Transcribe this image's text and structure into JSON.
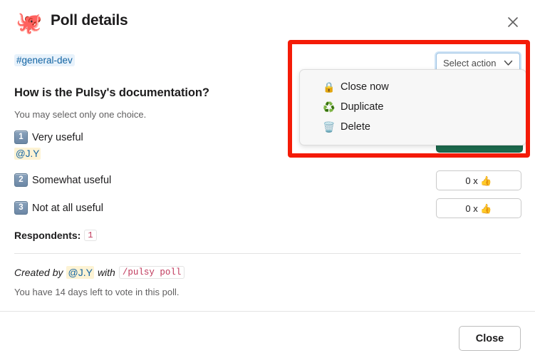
{
  "header": {
    "logo_glyph": "🐙",
    "title": "Poll details",
    "close_label": "×"
  },
  "body": {
    "channel": "#general-dev",
    "question": "How is the Pulsy's documentation?",
    "subtitle": "You may select only one choice.",
    "options": [
      {
        "number": "1",
        "label": "Very useful",
        "voters": "@J.Y",
        "vote_count": ""
      },
      {
        "number": "2",
        "label": "Somewhat useful",
        "voters": "",
        "vote_count": "0 x 👍"
      },
      {
        "number": "3",
        "label": "Not at all useful",
        "voters": "",
        "vote_count": "0 x 👍"
      }
    ],
    "respondents_label": "Respondents:",
    "respondents_count": "1",
    "created_by_prefix": "Created by",
    "created_by_user": "@J.Y",
    "created_with": "with",
    "created_command": "/pulsy poll",
    "expiry_note": "You have 14 days left to vote in this poll."
  },
  "actions": {
    "select_action_label": "Select action",
    "menu_items": [
      {
        "icon": "🔒",
        "label": "Close now"
      },
      {
        "icon": "♻️",
        "label": "Duplicate"
      },
      {
        "icon": "🗑️",
        "label": "Delete"
      }
    ]
  },
  "footer": {
    "close_button": "Close"
  },
  "colors": {
    "highlight_red": "#f41b07",
    "link_blue": "#1264a3",
    "green_button": "#1d6b4e",
    "code_crimson": "#c0395c"
  }
}
